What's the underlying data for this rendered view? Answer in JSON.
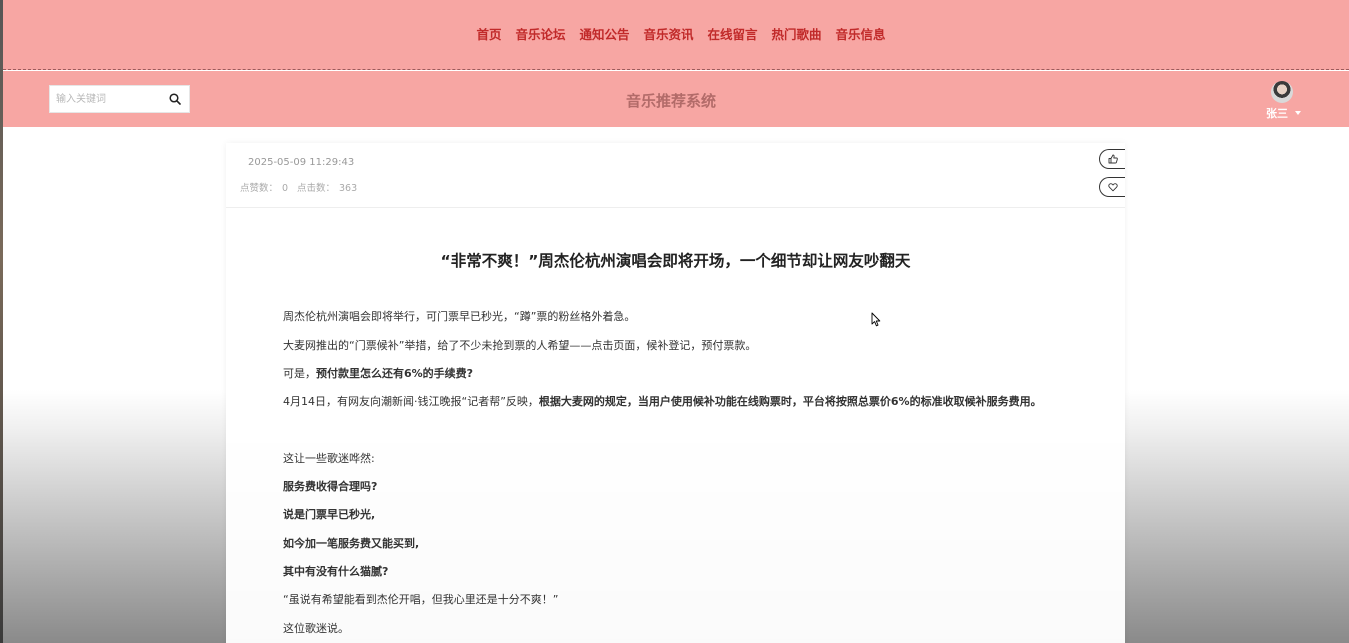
{
  "nav": {
    "items": [
      {
        "label": "首页"
      },
      {
        "label": "音乐论坛"
      },
      {
        "label": "通知公告"
      },
      {
        "label": "音乐资讯"
      },
      {
        "label": "在线留言"
      },
      {
        "label": "热门歌曲"
      },
      {
        "label": "音乐信息"
      }
    ]
  },
  "header": {
    "search_placeholder": "输入关键词",
    "site_title": "音乐推荐系统",
    "username": "张三"
  },
  "article": {
    "date": "2025-05-09 11:29:43",
    "likes_label": "点赞数：",
    "likes_value": "0",
    "clicks_label": "点击数：",
    "clicks_value": "363",
    "title": "“非常不爽！”周杰伦杭州演唱会即将开场，一个细节却让网友吵翻天",
    "p1": "周杰伦杭州演唱会即将举行，可门票早已秒光，“蹲”票的粉丝格外着急。",
    "p2": "大麦网推出的“门票候补”举措，给了不少未抢到票的人希望——点击页面，候补登记，预付票款。",
    "p3_prefix": "可是，",
    "p3_bold": "预付款里怎么还有6%的手续费?",
    "p4_prefix": "4月14日，有网友向潮新闻·钱江晚报“记者帮”反映，",
    "p4_bold": "根据大麦网的规定，当用户使用候补功能在线购票时，平台将按照总票价6%的标准收取候补服务费用。",
    "p5": "这让一些歌迷哗然:",
    "p6": "服务费收得合理吗?",
    "p7": "说是门票早已秒光,",
    "p8": "如今加一笔服务费又能买到,",
    "p9": "其中有没有什么猫腻?",
    "p10": "“虽说有希望能看到杰伦开唱，但我心里还是十分不爽！”",
    "p11": "这位歌迷说。"
  },
  "colors": {
    "header_bg": "#f7a6a3",
    "nav_text": "#c12a2a",
    "title_text": "#b26b69"
  },
  "icons": [
    "search-icon",
    "thumbs-up-icon",
    "heart-icon",
    "chevron-down-icon",
    "cursor-icon"
  ]
}
